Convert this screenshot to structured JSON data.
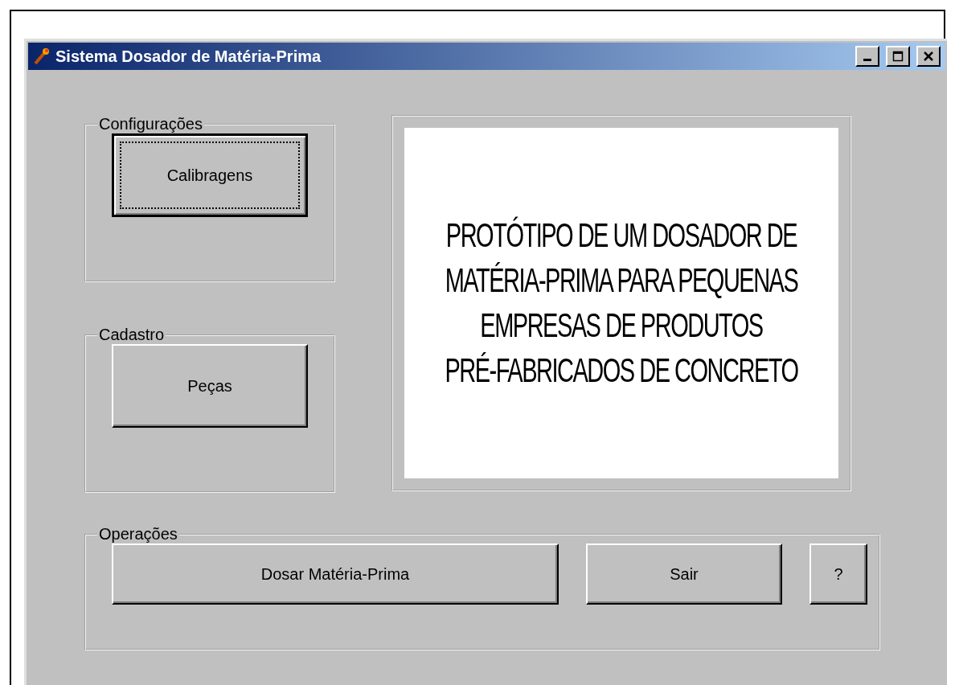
{
  "window": {
    "title": "Sistema Dosador de Matéria-Prima"
  },
  "groups": [
    {
      "title": "Configurações",
      "buttons": [
        {
          "label": "Calibragens",
          "default": true
        }
      ]
    },
    {
      "title": "Cadastro",
      "buttons": [
        {
          "label": "Peças",
          "default": false
        }
      ]
    }
  ],
  "banner": {
    "lines": [
      "PROTÓTIPO DE UM DOSADOR DE",
      "MATÉRIA-PRIMA PARA PEQUENAS",
      "EMPRESAS DE PRODUTOS",
      "PRÉ-FABRICADOS DE CONCRETO"
    ]
  },
  "operations": {
    "title": "Operações",
    "buttons": [
      {
        "label": "Dosar Matéria-Prima",
        "kind": "wide"
      },
      {
        "label": "Sair",
        "kind": "medium"
      },
      {
        "label": "?",
        "kind": "small"
      }
    ]
  }
}
